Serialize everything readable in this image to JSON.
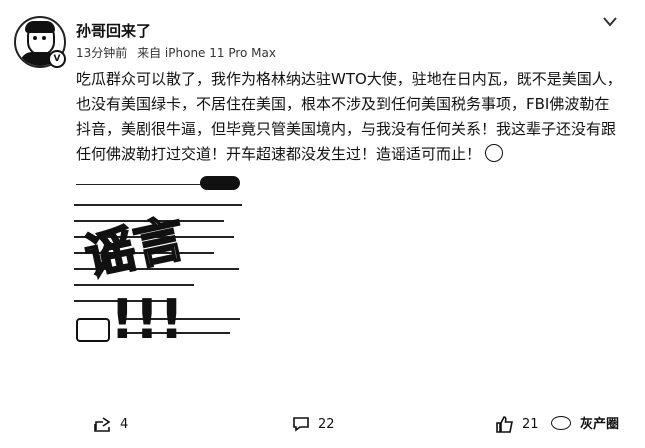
{
  "author": {
    "name": "孙哥回来了",
    "time": "13分钟前",
    "source": "来自 iPhone 11 Pro Max"
  },
  "post": {
    "text": "吃瓜群众可以散了，我作为格林纳达驻WTO大使，驻地在日内瓦，既不是美国人，也没有美国绿卡，不居住在美国，根本不涉及到任何美国税务事项，FBI佛波勒在抖音，美剧很牛逼，但毕竟只管美国境内，与我没有任何关系！我这辈子还没有跟任何佛波勒打过交道！开车超速都没发生过！造谣适可而止！"
  },
  "image": {
    "stamp_text": "谣言",
    "exclaim": "!!!"
  },
  "actions": {
    "share_count": "4",
    "comment_count": "22",
    "like_count": "21"
  },
  "watermark": {
    "text": "灰产圈"
  },
  "icons": [
    "chevron-down-icon",
    "share-icon",
    "comment-icon",
    "like-icon",
    "verified-icon"
  ]
}
